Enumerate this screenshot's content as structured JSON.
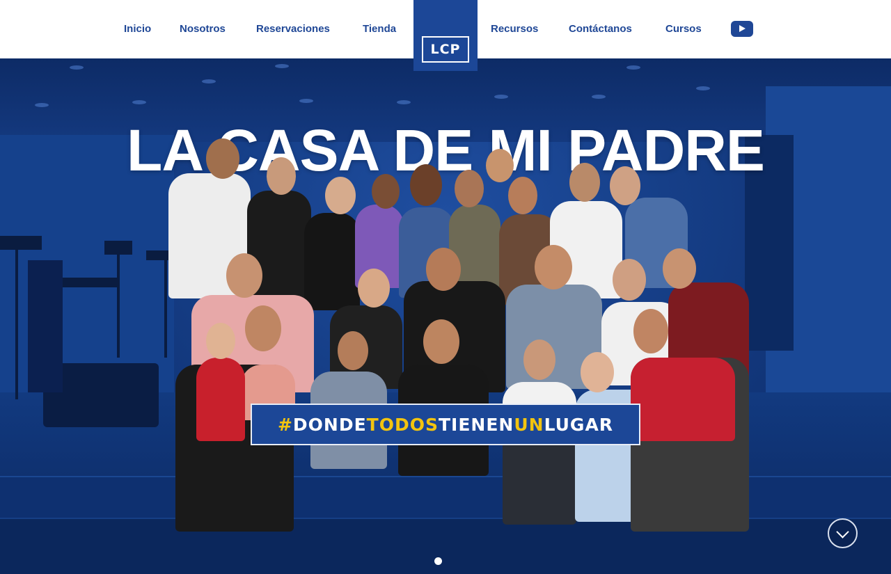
{
  "nav": {
    "items": [
      {
        "label": "Inicio"
      },
      {
        "label": "Nosotros"
      },
      {
        "label": "Reservaciones"
      },
      {
        "label": "Tienda"
      },
      {
        "label": "Recursos"
      },
      {
        "label": "Contáctanos"
      },
      {
        "label": "Cursos"
      }
    ],
    "logo_text": "LCP",
    "youtube_icon": "youtube-icon"
  },
  "hero": {
    "title": "LA CASA DE MI PADRE",
    "hashtag": [
      {
        "text": "#",
        "color": "#f2c40f"
      },
      {
        "text": "DONDE",
        "color": "#ffffff"
      },
      {
        "text": "TODOS",
        "color": "#f2c40f"
      },
      {
        "text": "TIENEN",
        "color": "#ffffff"
      },
      {
        "text": "UN",
        "color": "#f2c40f"
      },
      {
        "text": "LUGAR",
        "color": "#ffffff"
      }
    ],
    "scroll_icon": "chevron-down-icon"
  },
  "colors": {
    "brand_blue": "#1c4797",
    "nav_text": "#1f4796",
    "accent_yellow": "#f2c40f"
  }
}
